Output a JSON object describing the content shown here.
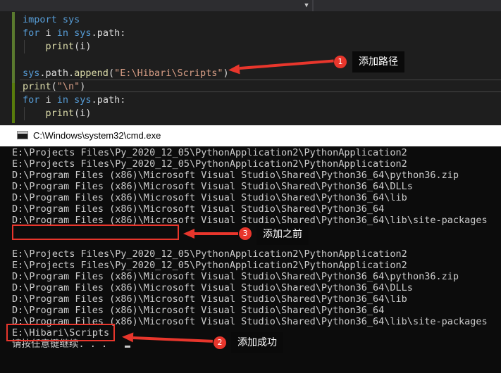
{
  "editor": {
    "code_lines": [
      {
        "parts": [
          {
            "t": "import",
            "c": "kw"
          },
          {
            "t": " sys",
            "c": "kw"
          }
        ]
      },
      {
        "parts": [
          {
            "t": "for",
            "c": "kw"
          },
          {
            "t": " i ",
            "c": "txt"
          },
          {
            "t": "in",
            "c": "kw"
          },
          {
            "t": " sys",
            "c": "kw"
          },
          {
            "t": ".path:",
            "c": "txt"
          }
        ]
      },
      {
        "parts": [
          {
            "t": "    ",
            "c": "txt"
          },
          {
            "t": "print",
            "c": "fn"
          },
          {
            "t": "(i)",
            "c": "txt"
          }
        ]
      },
      {
        "parts": []
      },
      {
        "parts": [
          {
            "t": "sys",
            "c": "kw"
          },
          {
            "t": ".path.",
            "c": "txt"
          },
          {
            "t": "append",
            "c": "fn"
          },
          {
            "t": "(",
            "c": "txt"
          },
          {
            "t": "\"E:\\Hibari\\Scripts\"",
            "c": "str"
          },
          {
            "t": ")",
            "c": "txt"
          }
        ]
      },
      {
        "parts": [
          {
            "t": "print",
            "c": "fn"
          },
          {
            "t": "(",
            "c": "txt"
          },
          {
            "t": "\"\\n\"",
            "c": "str"
          },
          {
            "t": ")",
            "c": "txt"
          }
        ]
      },
      {
        "parts": [
          {
            "t": "for",
            "c": "kw"
          },
          {
            "t": " i ",
            "c": "txt"
          },
          {
            "t": "in",
            "c": "kw"
          },
          {
            "t": " sys",
            "c": "kw"
          },
          {
            "t": ".path:",
            "c": "txt"
          }
        ]
      },
      {
        "parts": [
          {
            "t": "    ",
            "c": "txt"
          },
          {
            "t": "print",
            "c": "fn"
          },
          {
            "t": "(i)",
            "c": "txt"
          }
        ]
      }
    ]
  },
  "cmd": {
    "title": "C:\\Windows\\system32\\cmd.exe",
    "lines": [
      "E:\\Projects Files\\Py_2020_12_05\\PythonApplication2\\PythonApplication2",
      "E:\\Projects Files\\Py_2020_12_05\\PythonApplication2\\PythonApplication2",
      "D:\\Program Files (x86)\\Microsoft Visual Studio\\Shared\\Python36_64\\python36.zip",
      "D:\\Program Files (x86)\\Microsoft Visual Studio\\Shared\\Python36_64\\DLLs",
      "D:\\Program Files (x86)\\Microsoft Visual Studio\\Shared\\Python36_64\\lib",
      "D:\\Program Files (x86)\\Microsoft Visual Studio\\Shared\\Python36_64",
      "D:\\Program Files (x86)\\Microsoft Visual Studio\\Shared\\Python36_64\\lib\\site-packages",
      "",
      "",
      "E:\\Projects Files\\Py_2020_12_05\\PythonApplication2\\PythonApplication2",
      "E:\\Projects Files\\Py_2020_12_05\\PythonApplication2\\PythonApplication2",
      "D:\\Program Files (x86)\\Microsoft Visual Studio\\Shared\\Python36_64\\python36.zip",
      "D:\\Program Files (x86)\\Microsoft Visual Studio\\Shared\\Python36_64\\DLLs",
      "D:\\Program Files (x86)\\Microsoft Visual Studio\\Shared\\Python36_64\\lib",
      "D:\\Program Files (x86)\\Microsoft Visual Studio\\Shared\\Python36_64",
      "D:\\Program Files (x86)\\Microsoft Visual Studio\\Shared\\Python36_64\\lib\\site-packages",
      "E:\\Hibari\\Scripts",
      "请按任意键继续. . ."
    ]
  },
  "annotations": {
    "badge1": "1",
    "note1": "添加路径",
    "badge2": "2",
    "note2": "添加成功",
    "badge3": "3",
    "note3": "添加之前",
    "color": "#e8362c"
  }
}
